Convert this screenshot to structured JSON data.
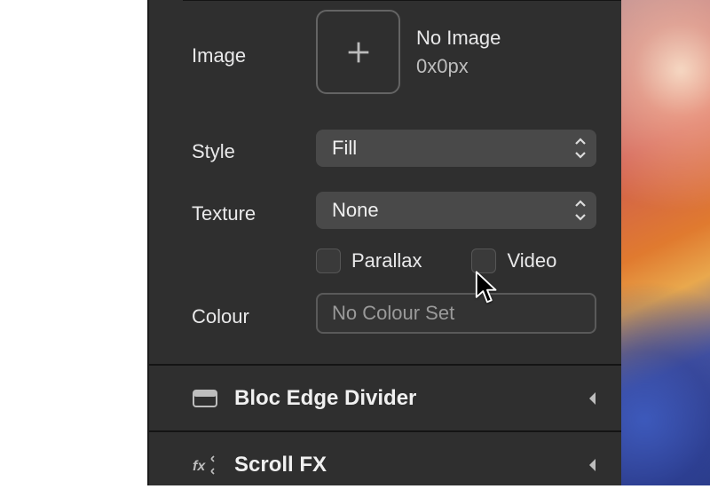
{
  "labels": {
    "image": "Image",
    "style": "Style",
    "texture": "Texture",
    "colour": "Colour"
  },
  "image": {
    "title": "No Image",
    "dimensions": "0x0px"
  },
  "style": {
    "value": "Fill"
  },
  "texture": {
    "value": "None"
  },
  "checkboxes": {
    "parallax": {
      "label": "Parallax",
      "checked": false
    },
    "video": {
      "label": "Video",
      "checked": false
    }
  },
  "colour": {
    "placeholder": "No Colour Set"
  },
  "sections": {
    "edgeDivider": "Bloc Edge Divider",
    "scrollFx": "Scroll FX"
  }
}
